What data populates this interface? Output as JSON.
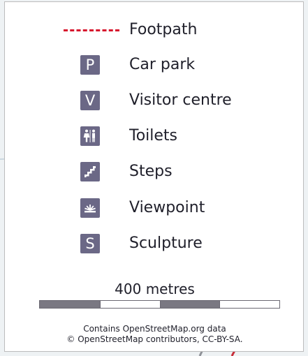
{
  "colors": {
    "symbol_fill": "#6b6886",
    "footpath": "#d7162d",
    "scale_dark": "#7a7882",
    "scale_light": "#ffffff",
    "panel_background": "#ffffff",
    "map_background": "#eef2f4"
  },
  "legend": {
    "items": [
      {
        "type": "footpath",
        "icon": "dashed-red-line",
        "label": "Footpath"
      },
      {
        "type": "car-park",
        "icon": "car-park-icon",
        "symbol": "P",
        "label": "Car park"
      },
      {
        "type": "visitor-centre",
        "icon": "visitor-centre-icon",
        "symbol": "V",
        "label": "Visitor centre"
      },
      {
        "type": "toilets",
        "icon": "toilets-icon",
        "label": "Toilets"
      },
      {
        "type": "steps",
        "icon": "steps-icon",
        "label": "Steps"
      },
      {
        "type": "viewpoint",
        "icon": "viewpoint-icon",
        "label": "Viewpoint"
      },
      {
        "type": "sculpture",
        "icon": "sculpture-icon",
        "symbol": "S",
        "label": "Sculpture"
      }
    ]
  },
  "scale": {
    "label": "400 metres",
    "segments": 4
  },
  "attribution": {
    "line1": "Contains OpenStreetMap.org data",
    "line2": "© OpenStreetMap contributors, CC-BY-SA."
  }
}
